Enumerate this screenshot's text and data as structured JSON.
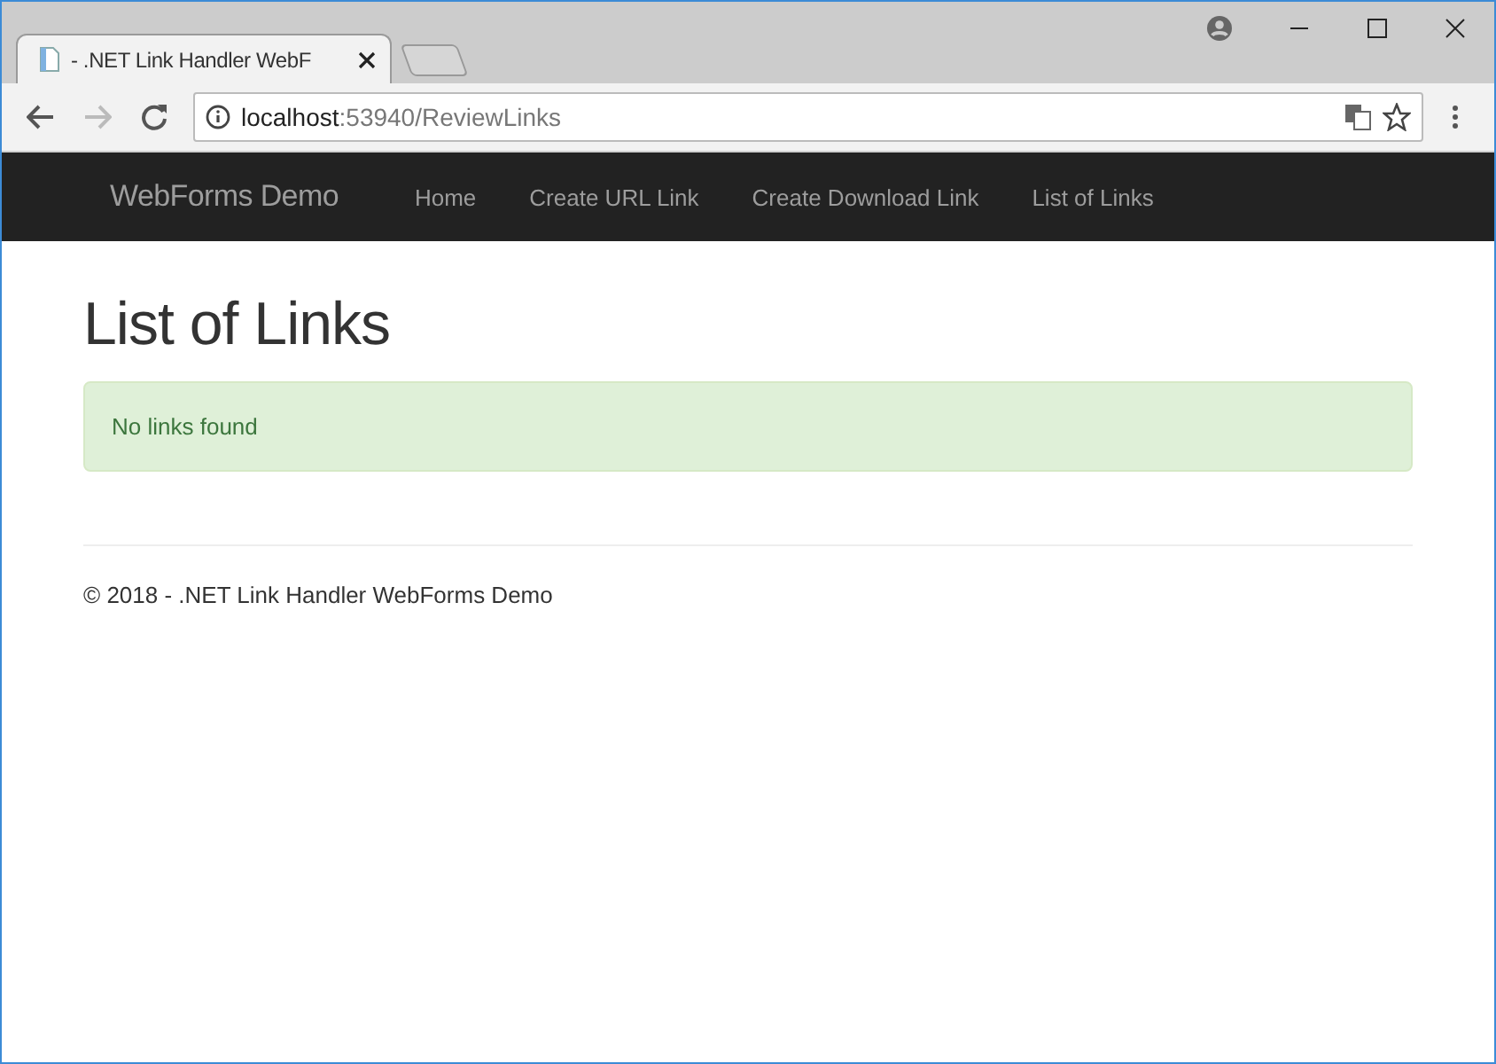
{
  "browser": {
    "tabs": [
      {
        "title": "- .NET Link Handler WebF",
        "selected": true
      }
    ],
    "address": {
      "host": "localhost",
      "path": ":53940/ReviewLinks"
    }
  },
  "navbar": {
    "brand": "WebForms Demo",
    "items": [
      {
        "label": "Home",
        "selected": false
      },
      {
        "label": "Create URL Link",
        "selected": false
      },
      {
        "label": "Create Download Link",
        "selected": false
      },
      {
        "label": "List of Links",
        "selected": false
      }
    ]
  },
  "page": {
    "heading": "List of Links",
    "alert": "No links found",
    "footer": "© 2018 - .NET Link Handler WebForms Demo"
  }
}
